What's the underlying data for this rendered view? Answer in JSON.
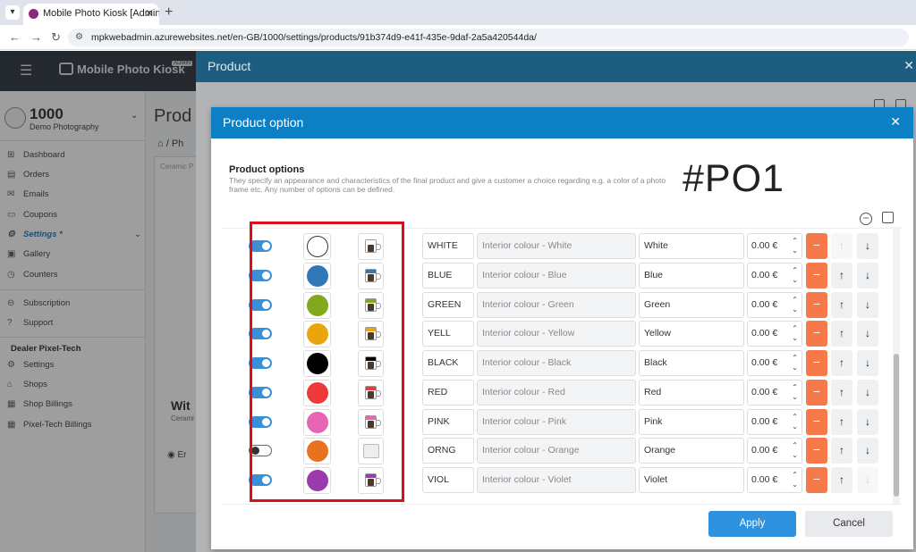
{
  "browser": {
    "tab_title": "Mobile Photo Kiosk [Admin]",
    "url": "mpkwebadmin.azurewebsites.net/en-GB/1000/settings/products/91b374d9-e41f-435e-9daf-2a5a420544da/"
  },
  "app": {
    "logo_text": "Mobile Photo Kiosk",
    "admin_badge": "ADMIN",
    "brand": {
      "number": "1000",
      "name": "Demo Photography"
    },
    "sidebar": {
      "items": [
        {
          "label": "Dashboard",
          "icon": "dashboard-icon"
        },
        {
          "label": "Orders",
          "icon": "orders-icon"
        },
        {
          "label": "Emails",
          "icon": "envelope-icon"
        },
        {
          "label": "Coupons",
          "icon": "coupon-icon"
        },
        {
          "label": "Settings *",
          "icon": "gear-icon"
        },
        {
          "label": "Gallery",
          "icon": "gallery-icon"
        },
        {
          "label": "Counters",
          "icon": "clock-icon"
        },
        {
          "label": "Subscription",
          "icon": "subscription-icon"
        },
        {
          "label": "Support",
          "icon": "help-icon"
        }
      ],
      "dealer_section": "Dealer Pixel-Tech",
      "dealer_items": [
        {
          "label": "Settings",
          "icon": "gear-icon"
        },
        {
          "label": "Shops",
          "icon": "shop-icon"
        },
        {
          "label": "Shop Billings",
          "icon": "billing-icon"
        },
        {
          "label": "Pixel-Tech Billings",
          "icon": "billing-icon"
        }
      ]
    },
    "main": {
      "title": "Prod",
      "crumb": "Ph",
      "card_label": "Ceramic P",
      "card_big": "Wit",
      "card_sub": "Cerami",
      "card_action": "Er"
    }
  },
  "product_dialog": {
    "title": "Product"
  },
  "option_modal": {
    "title": "Product option",
    "section_title": "Product options",
    "section_desc": "They specify an appearance and characteristics of the final product and give a customer a choice regarding e.g. a color of a photo frame etc. Any number of options can be defined.",
    "code": "#PO1",
    "rows": [
      {
        "enabled": true,
        "color": "#ffffff",
        "mug_color": "#ffffff",
        "code": "WHITE",
        "name": "Interior colour - White",
        "value": "White",
        "price": "0.00 €",
        "up_disabled": true,
        "down_disabled": false
      },
      {
        "enabled": true,
        "color": "#3078b8",
        "mug_color": "#3078b8",
        "code": "BLUE",
        "name": "Interior colour - Blue",
        "value": "Blue",
        "price": "0.00 €",
        "up_disabled": false,
        "down_disabled": false
      },
      {
        "enabled": true,
        "color": "#82a81e",
        "mug_color": "#82a81e",
        "code": "GREEN",
        "name": "Interior colour - Green",
        "value": "Green",
        "price": "0.00 €",
        "up_disabled": false,
        "down_disabled": false
      },
      {
        "enabled": true,
        "color": "#eba50c",
        "mug_color": "#eba50c",
        "code": "YELL",
        "name": "Interior colour - Yellow",
        "value": "Yellow",
        "price": "0.00 €",
        "up_disabled": false,
        "down_disabled": false
      },
      {
        "enabled": true,
        "color": "#000000",
        "mug_color": "#000000",
        "code": "BLACK",
        "name": "Interior colour - Black",
        "value": "Black",
        "price": "0.00 €",
        "up_disabled": false,
        "down_disabled": false
      },
      {
        "enabled": true,
        "color": "#f0393b",
        "mug_color": "#f0393b",
        "code": "RED",
        "name": "Interior colour - Red",
        "value": "Red",
        "price": "0.00 €",
        "up_disabled": false,
        "down_disabled": false
      },
      {
        "enabled": true,
        "color": "#e864b5",
        "mug_color": "#e864b5",
        "code": "PINK",
        "name": "Interior colour - Pink",
        "value": "Pink",
        "price": "0.00 €",
        "up_disabled": false,
        "down_disabled": false
      },
      {
        "enabled": false,
        "color": "#e8721f",
        "mug_color": "",
        "code": "ORNG",
        "name": "Interior colour - Orange",
        "value": "Orange",
        "price": "0.00 €",
        "up_disabled": false,
        "down_disabled": false
      },
      {
        "enabled": true,
        "color": "#9b3aad",
        "mug_color": "#9b3aad",
        "code": "VIOL",
        "name": "Interior colour - Violet",
        "value": "Violet",
        "price": "0.00 €",
        "up_disabled": false,
        "down_disabled": true
      }
    ],
    "apply_label": "Apply",
    "cancel_label": "Cancel"
  }
}
